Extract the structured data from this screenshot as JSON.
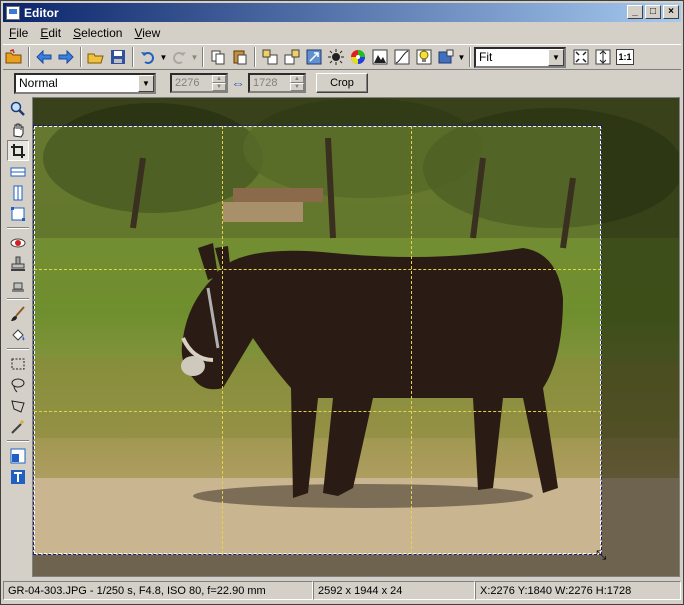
{
  "window": {
    "title": "Editor"
  },
  "titlebar": {
    "minimize": "_",
    "maximize": "□",
    "close": "×"
  },
  "menu": [
    "File",
    "Edit",
    "Selection",
    "View"
  ],
  "toolbar": {
    "zoom_mode": "Fit",
    "zoom_1to1": "1:1"
  },
  "crop_toolbar": {
    "mode": "Normal",
    "width": "2276",
    "height": "1728",
    "crop_label": "Crop"
  },
  "status": {
    "file_info": "GR-04-303.JPG - 1/250 s, F4.8, ISO 80, f=22.90 mm",
    "image_size": "2592 x 1944 x 24",
    "selection": "X:2276  Y:1840  W:2276  H:1728"
  }
}
